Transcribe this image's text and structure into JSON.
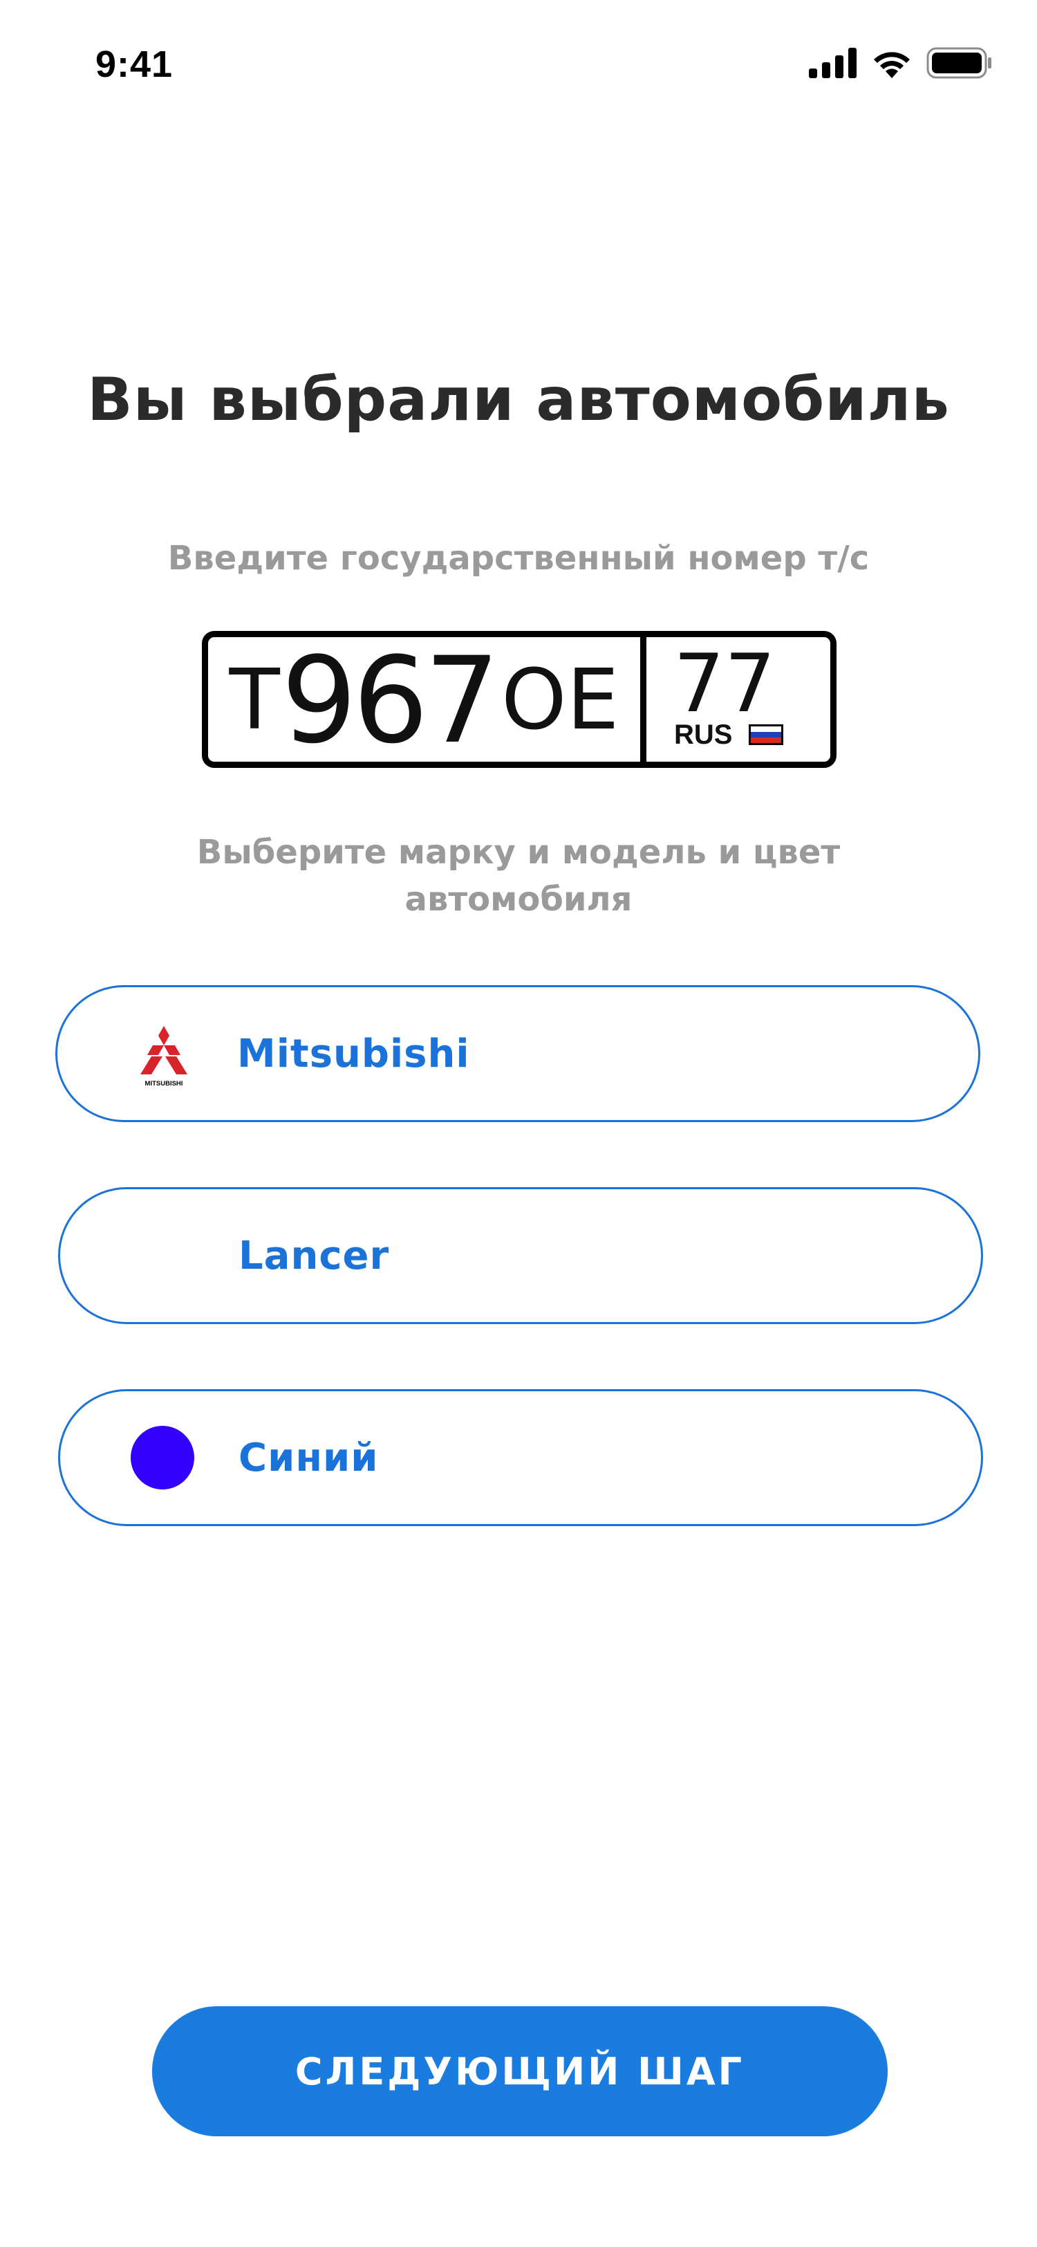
{
  "status_bar": {
    "time": "9:41"
  },
  "title": "Вы выбрали автомобиль",
  "plate_section": {
    "instruction": "Введите государственный номер т/с",
    "plate": {
      "letter_first": "Т",
      "digits": "967",
      "letters_last": "ОЕ",
      "region": "77",
      "country": "RUS"
    }
  },
  "car_section": {
    "instruction": "Выберите марку и модель и цвет автомобиля",
    "brand": {
      "label": "Mitsubishi",
      "logo_text": "MITSUBISHI",
      "logo_color": "#d8232a"
    },
    "model": {
      "label": "Lancer"
    },
    "color": {
      "label": "Синий",
      "swatch": "#3300ff"
    }
  },
  "next_button": {
    "label": "СЛЕДУЮЩИЙ ШАГ"
  },
  "theme": {
    "accent": "#1b72d8",
    "button": "#1b7cdf"
  }
}
